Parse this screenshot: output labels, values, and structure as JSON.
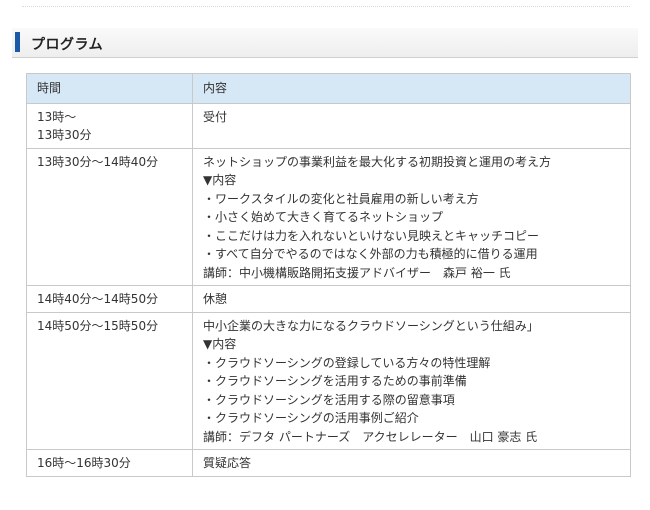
{
  "section": {
    "title": "プログラム"
  },
  "table": {
    "headers": [
      "時間",
      "内容"
    ],
    "rows": [
      {
        "time": [
          "13時～",
          "13時30分"
        ],
        "content": [
          "受付"
        ]
      },
      {
        "time": [
          "13時30分～14時40分"
        ],
        "content": [
          "ネットショップの事業利益を最大化する初期投資と運用の考え方",
          "▼内容",
          "・ワークスタイルの変化と社員雇用の新しい考え方",
          "・小さく始めて大きく育てるネットショップ",
          "・ここだけは力を入れないといけない見映えとキャッチコピー",
          "・すべて自分でやるのではなく外部の力も積極的に借りる運用",
          "講師：中小機構販路開拓支援アドバイザー　森戸 裕一 氏"
        ]
      },
      {
        "time": [
          "14時40分～14時50分"
        ],
        "content": [
          "休憩"
        ]
      },
      {
        "time": [
          "14時50分～15時50分"
        ],
        "content": [
          "中小企業の大きな力になるクラウドソーシングという仕組み」",
          "▼内容",
          "・クラウドソーシングの登録している方々の特性理解",
          "・クラウドソーシングを活用するための事前準備",
          "・クラウドソーシングを活用する際の留意事項",
          "・クラウドソーシングの活用事例ご紹介",
          "講師：デフタ パートナーズ　アクセレレーター　山口 豪志 氏"
        ]
      },
      {
        "time": [
          "16時～16時30分"
        ],
        "content": [
          "質疑応答"
        ]
      }
    ]
  },
  "colors": {
    "accent_bar": "#1a5aa8",
    "header_bg": "#d6e7f6",
    "border": "#c9c9c9"
  }
}
